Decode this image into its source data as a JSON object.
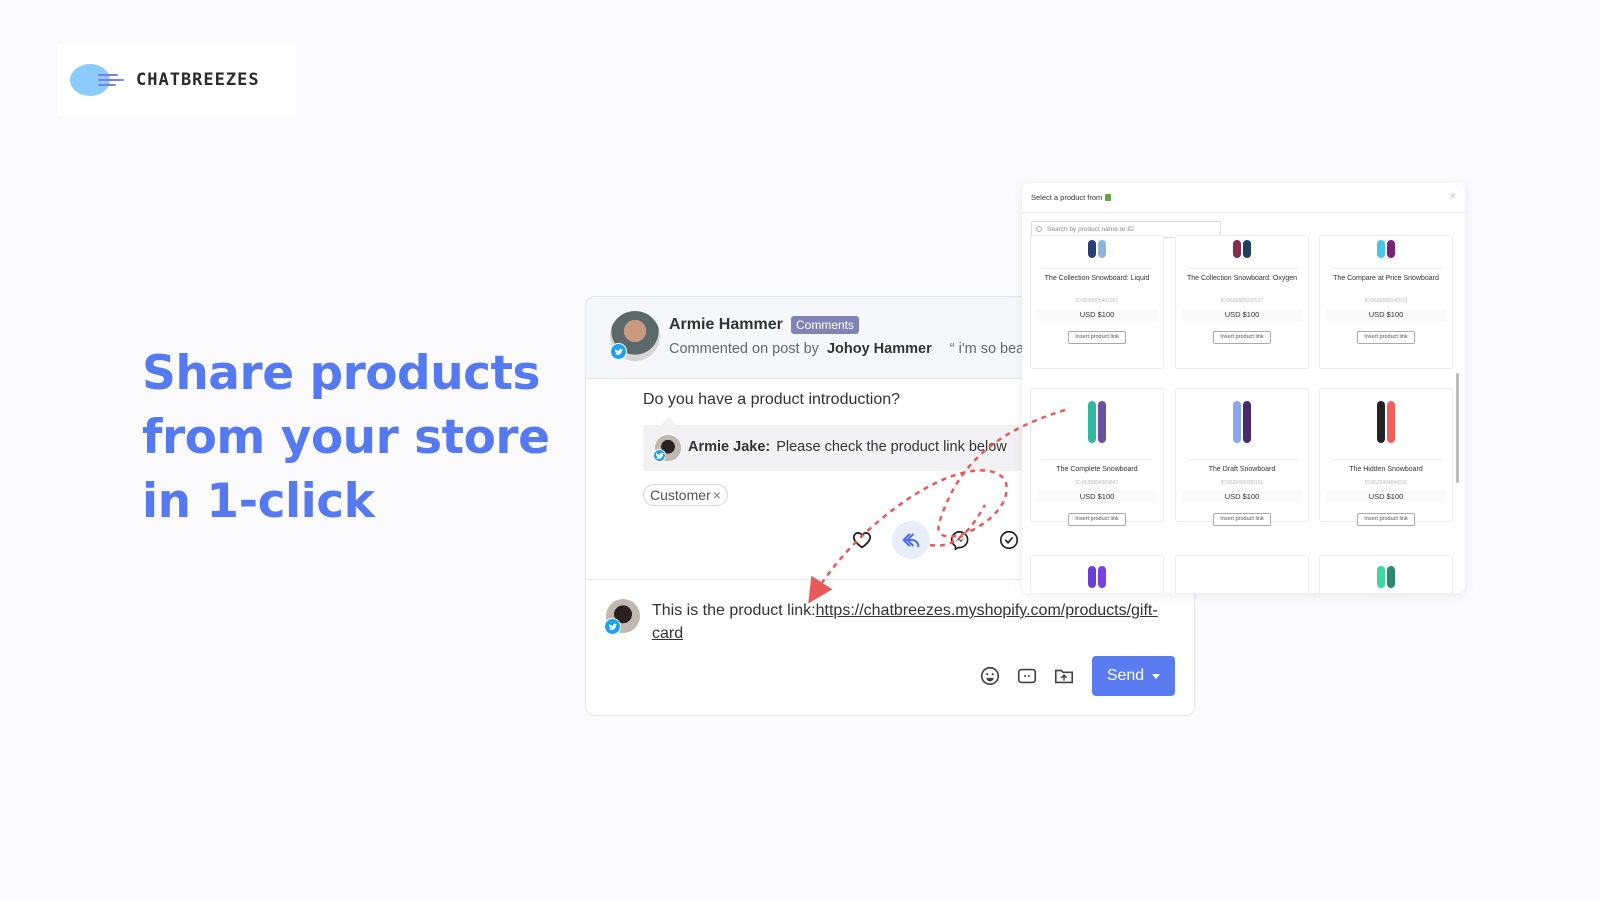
{
  "brand": {
    "logo_text": "CHATBREEZES",
    "accent_color": "#5479f0"
  },
  "headline": {
    "lines": [
      "Share products",
      "from your store",
      "in 1-click"
    ]
  },
  "conversation": {
    "author": "Armie Hammer",
    "source_badge": "Comments",
    "commented_prefix": "Commented on post by",
    "post_author": "Johoy Hammer",
    "post_excerpt": "“ i'm so beaut",
    "question": "Do you have a product introduction?",
    "reply": {
      "name": "Armie Jake:",
      "text": "Please check the product link below"
    },
    "tag": "Customer",
    "tag_remove": "×",
    "actions": [
      "heart-icon",
      "reply-icon",
      "messenger-icon",
      "check-circle-icon"
    ]
  },
  "composer": {
    "text_prefix": "This is the product link:",
    "link": "https://chatbreezes.myshopify.com/products/gift-card",
    "tools": [
      "emoji-icon",
      "quick-reply-icon",
      "upload-folder-icon"
    ],
    "send_label": "Send"
  },
  "picker": {
    "title": "Select a product from",
    "close": "×",
    "search_placeholder": "Search by product name or ID",
    "products": [
      {
        "name": "The Collection Snowboard: Liquid",
        "id": "ID:8635805401367",
        "price": "USD $100",
        "button": "Insert product link",
        "colors": [
          "#2c3e78",
          "#8fb4d8"
        ]
      },
      {
        "name": "The Collection Snowboard: Oxygen",
        "id": "ID:8635805237527",
        "price": "USD $100",
        "button": "Insert product link",
        "colors": [
          "#8a2a4c",
          "#1f3f5a"
        ]
      },
      {
        "name": "The Compare at Price Snowboard",
        "id": "ID:8635805040919",
        "price": "USD $100",
        "button": "Insert product link",
        "colors": [
          "#48c6e8",
          "#7a1f7a"
        ]
      },
      {
        "name": "The Complete Snowboard",
        "id": "ID:8635804909847",
        "price": "USD $100",
        "button": "Insert product link",
        "colors": [
          "#2fb9a0",
          "#6a4fa0"
        ]
      },
      {
        "name": "The Draft Snowboard",
        "id": "ID:8635805008151",
        "price": "USD $100",
        "button": "Insert product link",
        "colors": [
          "#8aa8f0",
          "#4a2a6a"
        ]
      },
      {
        "name": "The Hidden Snowboard",
        "id": "ID:8635804844311",
        "price": "USD $100",
        "button": "Insert product link",
        "colors": [
          "#222222",
          "#f0605a"
        ]
      },
      {
        "name": "",
        "id": "",
        "price": "",
        "button": "",
        "colors": [
          "#6a3cd8",
          "#7d40e0"
        ]
      },
      {
        "name": "",
        "id": "",
        "price": "",
        "button": "",
        "colors": [
          "#666666",
          "#666666"
        ]
      },
      {
        "name": "",
        "id": "",
        "price": "",
        "button": "",
        "colors": [
          "#3ad9a0",
          "#2a8a6a"
        ]
      }
    ]
  }
}
